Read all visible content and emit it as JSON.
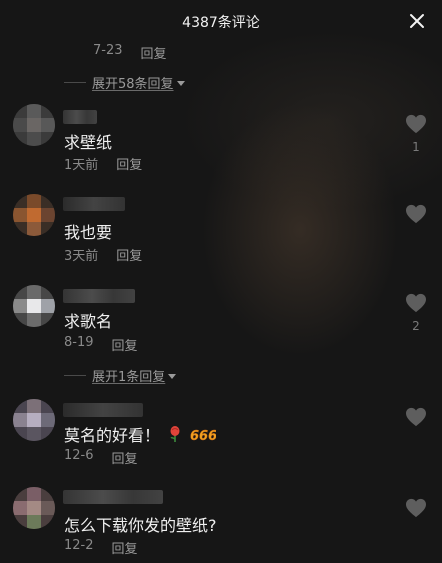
{
  "header": {
    "title": "4387条评论",
    "close_icon": "close-icon"
  },
  "top_meta": {
    "date": "7-23",
    "reply": "回复"
  },
  "top_expand": {
    "label": "展开58条回复"
  },
  "comments": [
    {
      "text": "求壁纸",
      "date": "1天前",
      "reply": "回复",
      "likes": "1",
      "avatar": "blurred-avatar"
    },
    {
      "text": "我也要",
      "date": "3天前",
      "reply": "回复",
      "likes": "",
      "avatar": "blurred-avatar"
    },
    {
      "text": "求歌名",
      "date": "8-19",
      "reply": "回复",
      "likes": "2",
      "avatar": "blurred-avatar"
    },
    {
      "text": "莫名的好看！",
      "date": "12-6",
      "reply": "回复",
      "likes": "",
      "avatar": "blurred-avatar",
      "emoji": [
        "rose-emoji",
        "666-emoji"
      ]
    },
    {
      "text": "怎么下载你发的壁纸?",
      "date": "12-2",
      "reply": "回复",
      "likes": "",
      "avatar": "blurred-avatar"
    }
  ],
  "expand_after_3": {
    "label": "展开1条回复"
  },
  "colors": {
    "background": "#161616",
    "text": "#f0f0f0",
    "meta": "#8a8a8a",
    "heart": "#5e5e5e"
  }
}
